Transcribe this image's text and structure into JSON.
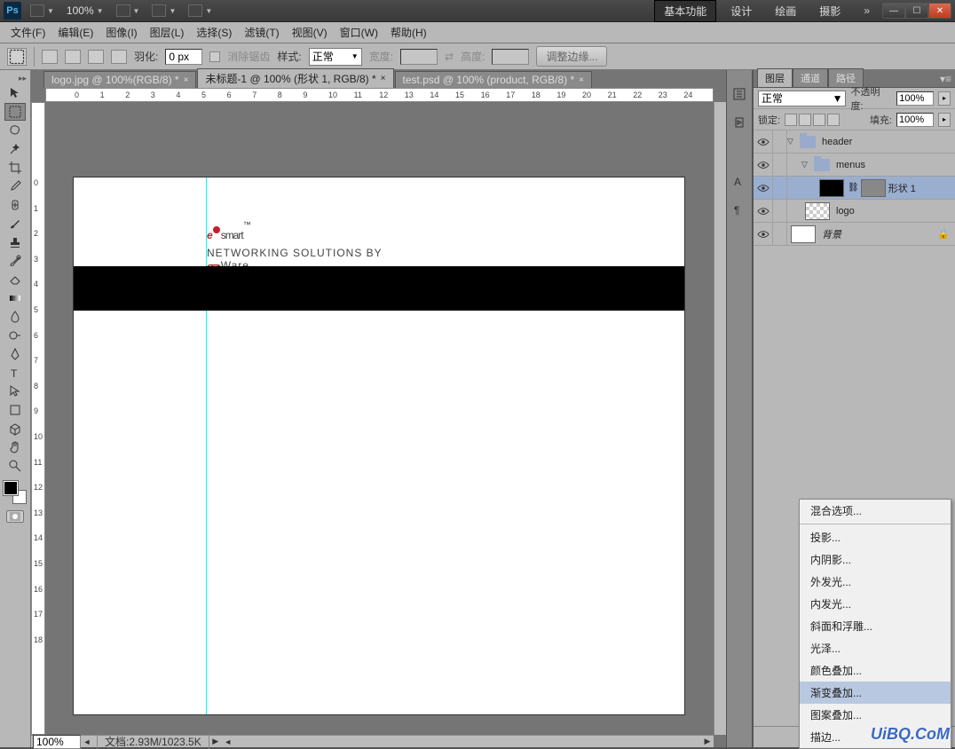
{
  "titlebar": {
    "zoom": "100%",
    "workspaces": {
      "basic": "基本功能",
      "design": "设计",
      "paint": "绘画",
      "photo": "摄影"
    }
  },
  "menu": {
    "file": "文件(F)",
    "edit": "编辑(E)",
    "image": "图像(I)",
    "layer": "图层(L)",
    "select": "选择(S)",
    "filter": "滤镜(T)",
    "view": "视图(V)",
    "window": "窗口(W)",
    "help": "帮助(H)"
  },
  "options": {
    "feather_label": "羽化:",
    "feather_value": "0 px",
    "antialias": "消除锯齿",
    "style_label": "样式:",
    "style_value": "正常",
    "width_label": "宽度:",
    "height_label": "高度:",
    "refine": "调整边缘..."
  },
  "tabs": [
    {
      "label": "logo.jpg @ 100%(RGB/8) *"
    },
    {
      "label": "未标题-1 @ 100% (形状 1, RGB/8) *"
    },
    {
      "label": "test.psd @ 100% (product, RGB/8) *"
    }
  ],
  "ruler_h": [
    "0",
    "1",
    "2",
    "3",
    "4",
    "5",
    "6",
    "7",
    "8",
    "9",
    "10",
    "11",
    "12",
    "13",
    "14",
    "15",
    "16",
    "17",
    "18",
    "19",
    "20",
    "21",
    "22",
    "23",
    "24"
  ],
  "ruler_v": [
    "0",
    "1",
    "2",
    "3",
    "4",
    "5",
    "6",
    "7",
    "8",
    "9",
    "10",
    "11",
    "12",
    "13",
    "14",
    "15",
    "16",
    "17",
    "18"
  ],
  "canvas": {
    "logo_main": "smart",
    "logo_sub": "NETWORKING SOLUTIONS BY ",
    "logo_brand": "em",
    "logo_ware": "Ware",
    "tm": "™"
  },
  "statusbar": {
    "zoom": "100%",
    "info": "文档:2.93M/1023.5K"
  },
  "panels": {
    "tabs": {
      "layers": "图层",
      "channels": "通道",
      "paths": "路径"
    },
    "blend_mode": "正常",
    "opacity_label": "不透明度:",
    "opacity_value": "100%",
    "lock_label": "锁定:",
    "fill_label": "填充:",
    "fill_value": "100%",
    "layers": [
      {
        "name": "header",
        "type": "folder",
        "indent": 0
      },
      {
        "name": "menus",
        "type": "folder",
        "indent": 1
      },
      {
        "name": "形状 1",
        "type": "shape",
        "indent": 2,
        "selected": true
      },
      {
        "name": "logo",
        "type": "raster",
        "indent": 1
      },
      {
        "name": "背景",
        "type": "bg",
        "indent": 0,
        "locked": true
      }
    ]
  },
  "context_menu": {
    "items": [
      "混合选项...",
      "-",
      "投影...",
      "内阴影...",
      "外发光...",
      "内发光...",
      "斜面和浮雕...",
      "光泽...",
      "颜色叠加...",
      "渐变叠加...",
      "图案叠加...",
      "描边..."
    ],
    "highlighted": "渐变叠加..."
  },
  "watermark": "UiBQ.CoM"
}
